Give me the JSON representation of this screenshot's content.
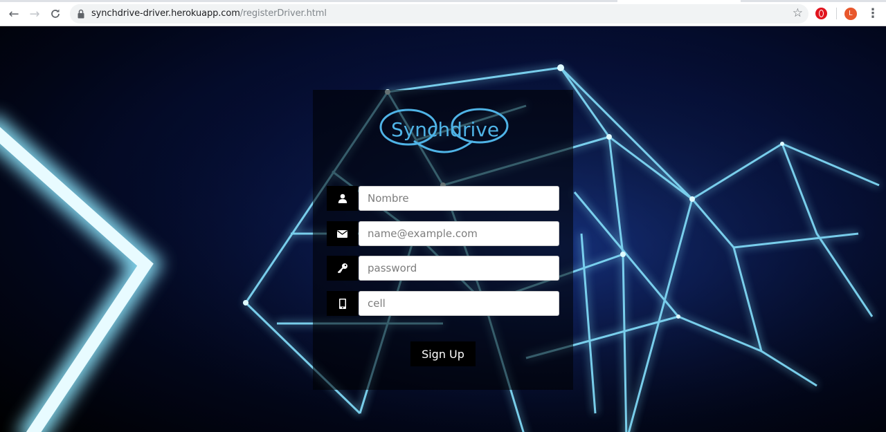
{
  "browser": {
    "url_host": "synchdrive-driver.herokuapp.com",
    "url_path": "/registerDriver.html",
    "profile_initial": "L"
  },
  "brand": {
    "logo_text": "Synchdrive",
    "logo_color": "#4fb3e6"
  },
  "form": {
    "name_placeholder": "Nombre",
    "email_placeholder": "name@example.com",
    "password_placeholder": "password",
    "cell_placeholder": "cell",
    "submit_label": "Sign Up"
  },
  "icons": {
    "name": "user-icon",
    "email": "envelope-icon",
    "password": "key-icon",
    "cell": "mobile-phone-icon"
  }
}
